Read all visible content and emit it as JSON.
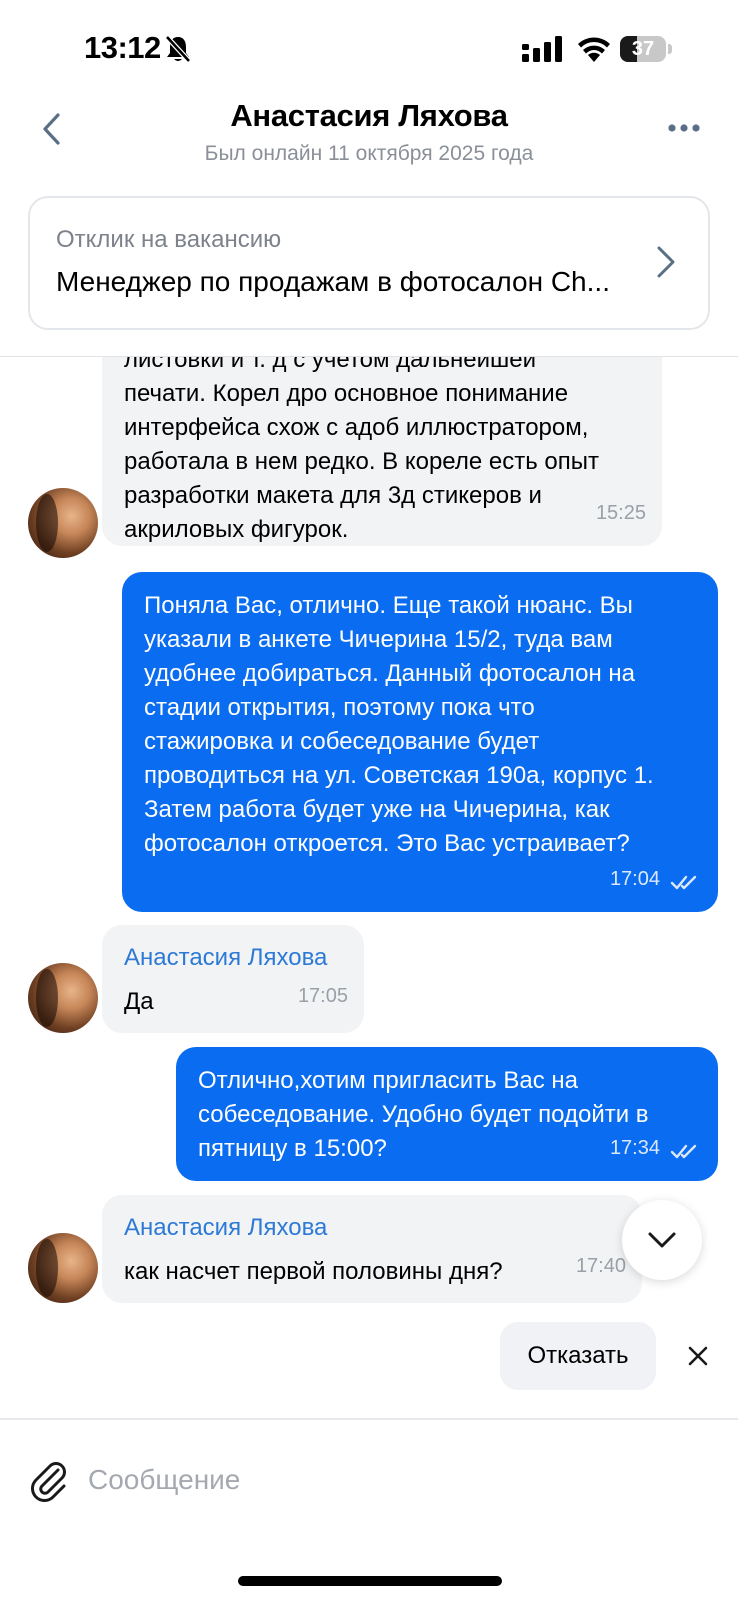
{
  "status_bar": {
    "time": "13:12",
    "battery_level": "37",
    "battery_fraction": 0.37
  },
  "header": {
    "title": "Анастасия Ляхова",
    "subtitle": "Был онлайн 11 октября 2025 года"
  },
  "vacancy": {
    "label": "Отклик на вакансию",
    "title": "Менеджер по продажам в фотосалон Ch..."
  },
  "messages": [
    {
      "direction": "incoming",
      "text": "листовки и т. д с учетом дальнейшей\nпечати. Корел дро основное понимание\nинтерфейса  схож с адоб иллюстратором,\nработала в нем редко. В кореле есть опыт\nразработки макета для 3д стикеров и\nакриловых фигурок.",
      "time": "15:25"
    },
    {
      "direction": "outgoing",
      "text": "Поняла Вас, отлично. Еще такой нюанс. Вы\nуказали в анкете Чичерина 15/2, туда вам\nудобнее добираться. Данный фотосалон на\nстадии открытия, поэтому пока что\nстажировка и собеседование будет\nпроводиться на ул. Советская 190а, корпус 1.\nЗатем работа будет уже на Чичерина, как\nфотосалон откроется. Это Вас устраивает?",
      "time": "17:04",
      "status": "read"
    },
    {
      "direction": "incoming",
      "sender": "Анастасия Ляхова",
      "text": "Да",
      "time": "17:05"
    },
    {
      "direction": "outgoing",
      "text": "Отлично,хотим пригласить Вас на\nсобеседование. Удобно будет подойти в\nпятницу в 15:00?",
      "time": "17:34",
      "status": "read"
    },
    {
      "direction": "incoming",
      "sender": "Анастасия Ляхова",
      "text": "как насчет первой половины  дня?",
      "time": "17:40"
    }
  ],
  "quick_reply": {
    "reject_label": "Отказать"
  },
  "composer": {
    "placeholder": "Сообщение"
  },
  "colors": {
    "accent": "#0a6cf0",
    "sender_name": "#2d7ad6",
    "incoming_bubble": "#f2f3f5"
  }
}
